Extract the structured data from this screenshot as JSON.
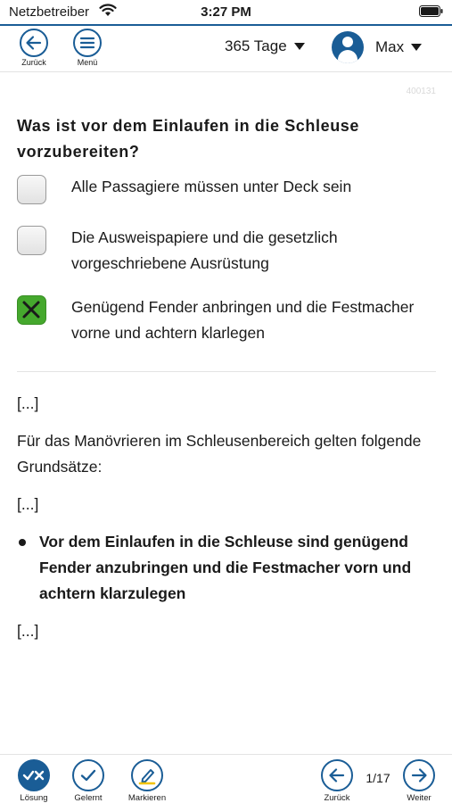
{
  "status_bar": {
    "carrier": "Netzbetreiber",
    "time": "3:27 PM"
  },
  "nav": {
    "back_label": "Zurück",
    "menu_label": "Menü",
    "period": "365 Tage",
    "user": "Max"
  },
  "question": {
    "id": "400131",
    "text": "Was ist vor dem Einlaufen in die Schleuse vorzubereiten?",
    "answers": [
      {
        "text": "Alle Passagiere müssen unter Deck sein",
        "checked": false
      },
      {
        "text": "Die Ausweispapiere und die gesetzlich vorgeschriebene Ausrüstung",
        "checked": false
      },
      {
        "text": "Genügend Fender anbringen und die Festmacher vorne und achtern klarlegen",
        "checked": true
      }
    ]
  },
  "explanation": {
    "ellipsis_1": "[...]",
    "intro": "Für das Manövrieren im Schleusenbereich gelten folgende Grundsätze:",
    "ellipsis_2": "[...]",
    "bullet": "Vor dem Einlaufen in die Schleuse sind genügend Fender anzubringen und die Festmacher vorn und achtern klarzulegen",
    "ellipsis_3": "[...]"
  },
  "toolbar": {
    "solution_label": "Lösung",
    "learned_label": "Gelernt",
    "mark_label": "Markieren",
    "prev_label": "Zurück",
    "page": "1/17",
    "next_label": "Weiter"
  },
  "colors": {
    "accent": "#1a5d96",
    "correct": "#45a82d"
  }
}
